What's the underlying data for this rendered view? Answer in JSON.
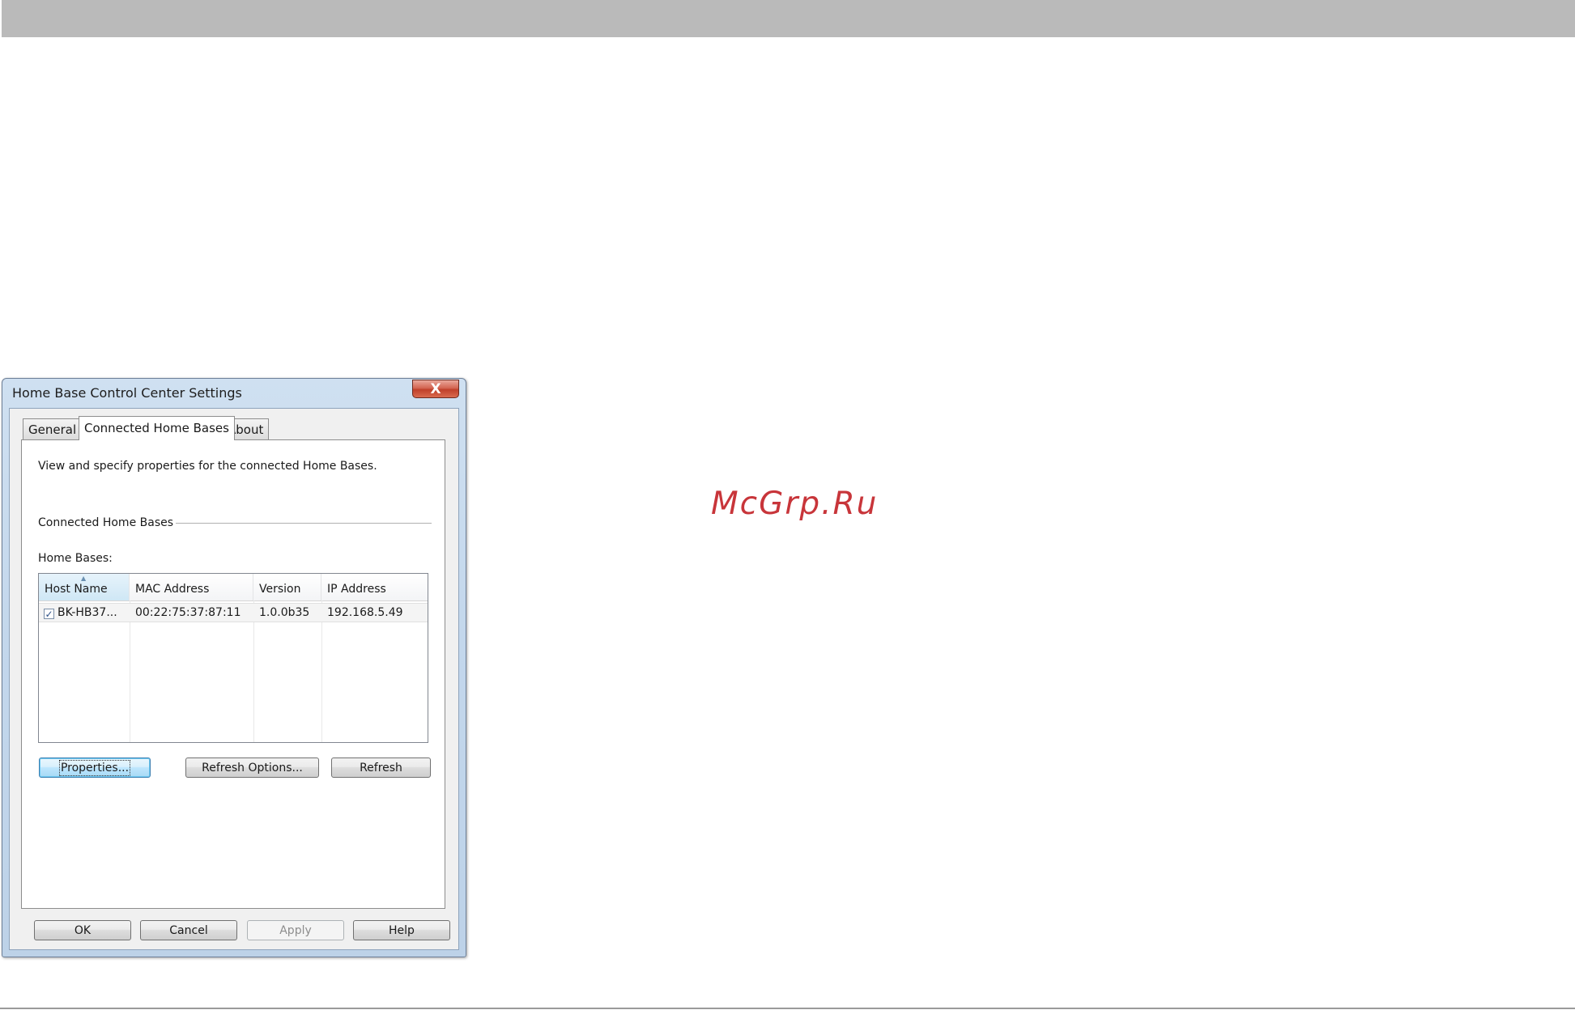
{
  "watermark": "McGrp.Ru",
  "dialog": {
    "title": "Home Base Control Center Settings",
    "close_label": "X"
  },
  "tabs": [
    {
      "label": "General",
      "active": false
    },
    {
      "label": "Connected Home Bases",
      "active": true
    },
    {
      "label": "About",
      "active": false
    }
  ],
  "panel": {
    "description": "View and specify properties for the connected Home Bases.",
    "group_label": "Connected Home Bases",
    "list_label": "Home Bases:"
  },
  "list": {
    "columns": [
      "Host Name",
      "MAC Address",
      "Version",
      "IP Address"
    ],
    "sorted_column": "Host Name",
    "rows": [
      {
        "checked": true,
        "host": "BK-HB37...",
        "mac": "00:22:75:37:87:11",
        "version": "1.0.0b35",
        "ip": "192.168.5.49"
      }
    ]
  },
  "buttons": {
    "properties": "Properties...",
    "refresh_options": "Refresh Options...",
    "refresh": "Refresh",
    "ok": "OK",
    "cancel": "Cancel",
    "apply": "Apply",
    "help": "Help"
  }
}
